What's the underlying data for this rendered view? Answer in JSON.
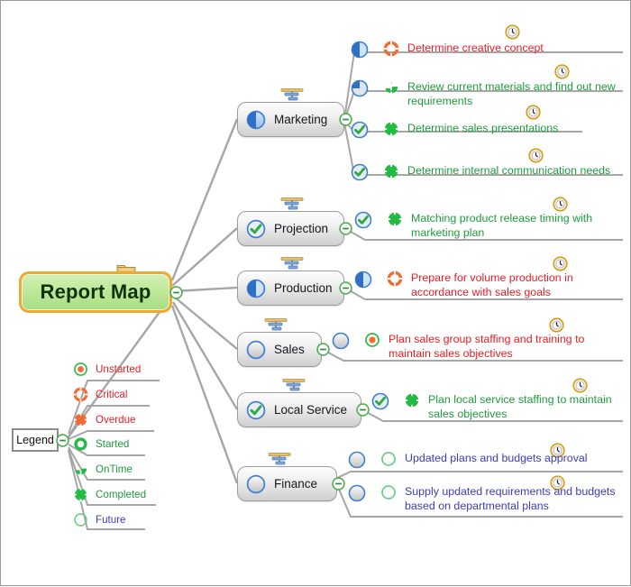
{
  "diagram": {
    "type": "mind-map",
    "title": "Report Map",
    "colors": {
      "central_fill": "#bfe89a",
      "central_border": "#f0a830",
      "branch_fill": "#e9e9e9",
      "branch_border": "#9d9d9d",
      "connector": "#a6a6a6",
      "text_red": "#ed1c24",
      "text_green": "#1f9b3c",
      "text_blue": "#3b3bbf",
      "collapse_green": "#4caf50",
      "progress_blue": "#3f7fd0",
      "status_green": "#22bb44",
      "status_orange": "#f26a35",
      "clock_gold": "#d4a017",
      "canvas": "#ffffff"
    }
  },
  "central": {
    "label": "Report Map",
    "folder_icon": "folder-icon",
    "collapse_icon": "collapse-minus-icon"
  },
  "branches": [
    {
      "id": "marketing",
      "label": "Marketing",
      "progress_icon": "progress-50-icon",
      "progress_percent": 50,
      "taskbar_icon": "task-info-icon",
      "collapse_icon": "collapse-minus-icon",
      "tasks": [
        {
          "text": "Determine creative concept",
          "progress_icon": "progress-50-icon",
          "progress_percent": 50,
          "status_icon": "critical-icon",
          "status": "Critical",
          "text_color": "red",
          "clock_icon": "clock-icon"
        },
        {
          "text": "Review current materials and find out new requirements",
          "progress_icon": "progress-25-icon",
          "progress_percent": 25,
          "status_icon": "ontime-icon",
          "status": "OnTime",
          "text_color": "green",
          "clock_icon": "clock-icon"
        },
        {
          "text": "Determine sales presentations",
          "progress_icon": "progress-100-icon",
          "progress_percent": 100,
          "status_icon": "completed-icon",
          "status": "Completed",
          "text_color": "green",
          "clock_icon": "clock-icon"
        },
        {
          "text": "Determine internal communication needs",
          "progress_icon": "progress-100-icon",
          "progress_percent": 100,
          "status_icon": "completed-icon",
          "status": "Completed",
          "text_color": "green",
          "clock_icon": "clock-icon"
        }
      ]
    },
    {
      "id": "projection",
      "label": "Projection",
      "progress_icon": "progress-100-icon",
      "progress_percent": 100,
      "taskbar_icon": "task-info-icon",
      "collapse_icon": "collapse-minus-icon",
      "tasks": [
        {
          "text": "Matching product release timing with marketing plan",
          "progress_icon": "progress-100-icon",
          "progress_percent": 100,
          "status_icon": "completed-icon",
          "status": "Completed",
          "text_color": "green",
          "clock_icon": "clock-icon"
        }
      ]
    },
    {
      "id": "production",
      "label": "Production",
      "progress_icon": "progress-50-icon",
      "progress_percent": 50,
      "taskbar_icon": "task-info-icon",
      "collapse_icon": "collapse-minus-icon",
      "tasks": [
        {
          "text": "Prepare for volume production in accordance with sales goals",
          "progress_icon": "progress-50-icon",
          "progress_percent": 50,
          "status_icon": "critical-icon",
          "status": "Critical",
          "text_color": "red",
          "clock_icon": "clock-icon"
        }
      ]
    },
    {
      "id": "sales",
      "label": "Sales",
      "progress_icon": "progress-0-icon",
      "progress_percent": 0,
      "taskbar_icon": "task-info-icon",
      "collapse_icon": "collapse-minus-icon",
      "tasks": [
        {
          "text": "Plan sales group staffing and training to maintain sales objectives",
          "progress_icon": "progress-0-icon",
          "progress_percent": 0,
          "status_icon": "unstarted-icon",
          "status": "Unstarted",
          "text_color": "red",
          "clock_icon": "clock-icon"
        }
      ]
    },
    {
      "id": "local-service",
      "label": "Local Service",
      "progress_icon": "progress-100-icon",
      "progress_percent": 100,
      "taskbar_icon": "task-info-icon",
      "collapse_icon": "collapse-minus-icon",
      "tasks": [
        {
          "text": "Plan local service staffing to maintain sales objectives",
          "progress_icon": "progress-100-icon",
          "progress_percent": 100,
          "status_icon": "completed-icon",
          "status": "Completed",
          "text_color": "green",
          "clock_icon": "clock-icon"
        }
      ]
    },
    {
      "id": "finance",
      "label": "Finance",
      "progress_icon": "progress-0-icon",
      "progress_percent": 0,
      "taskbar_icon": "task-info-icon",
      "collapse_icon": "collapse-minus-icon",
      "tasks": [
        {
          "text": "Updated plans and budgets approval",
          "progress_icon": "progress-0-icon",
          "progress_percent": 0,
          "status_icon": "future-icon",
          "status": "Future",
          "text_color": "blue",
          "clock_icon": "clock-icon"
        },
        {
          "text": "Supply updated requirements and budgets based on departmental plans",
          "progress_icon": "progress-0-icon",
          "progress_percent": 0,
          "status_icon": "future-icon",
          "status": "Future",
          "text_color": "blue",
          "clock_icon": "clock-icon"
        }
      ]
    }
  ],
  "legend": {
    "label": "Legend",
    "collapse_icon": "collapse-minus-icon",
    "items": [
      {
        "label": "Unstarted",
        "icon": "unstarted-icon",
        "text_color": "red"
      },
      {
        "label": "Critical",
        "icon": "critical-icon",
        "text_color": "red"
      },
      {
        "label": "Overdue",
        "icon": "overdue-icon",
        "text_color": "red"
      },
      {
        "label": "Started",
        "icon": "started-icon",
        "text_color": "green"
      },
      {
        "label": "OnTime",
        "icon": "ontime-icon",
        "text_color": "green"
      },
      {
        "label": "Completed",
        "icon": "completed-icon",
        "text_color": "green"
      },
      {
        "label": "Future",
        "icon": "future-icon",
        "text_color": "blue"
      }
    ]
  }
}
